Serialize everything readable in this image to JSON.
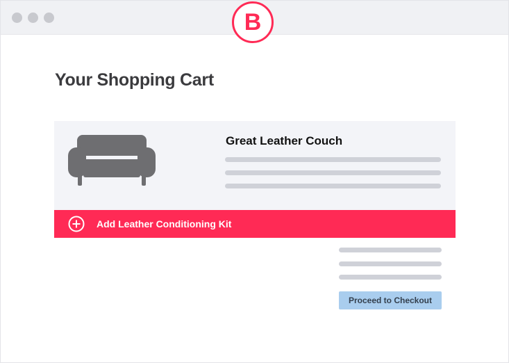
{
  "window": {
    "controls": [
      "window-dot-1",
      "window-dot-2",
      "window-dot-3"
    ]
  },
  "variant_badge": {
    "label": "B"
  },
  "page": {
    "title": "Your Shopping Cart"
  },
  "product": {
    "name": "Great Leather Couch",
    "image_icon": "couch-icon"
  },
  "upsell": {
    "label": "Add Leather Conditioning Kit",
    "icon": "plus-circle-icon"
  },
  "checkout": {
    "button_label": "Proceed to Checkout"
  },
  "colors": {
    "accent": "#ff2a55",
    "card_background": "#f3f4f8",
    "checkout_button": "#a9cdee",
    "placeholder": "#cfd1d8",
    "title_text": "#3b3b3e"
  }
}
